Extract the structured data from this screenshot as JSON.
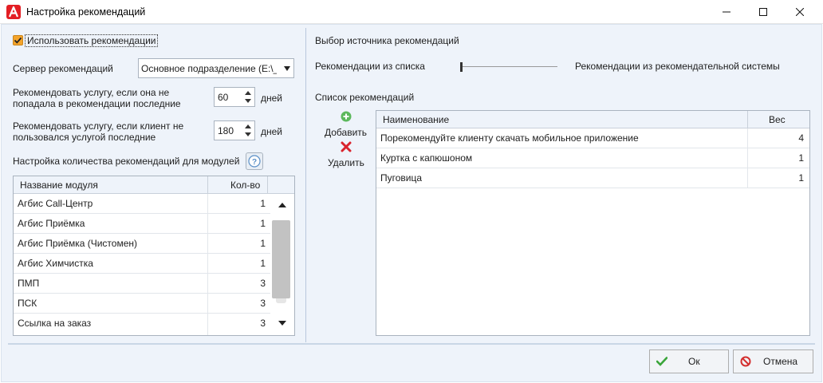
{
  "window": {
    "title": "Настройка рекомендаций"
  },
  "left": {
    "use_recommendations": {
      "label": "Использовать рекомендации",
      "checked": true
    },
    "server": {
      "label": "Сервер рекомендаций",
      "value": "Основное подразделение (E:\\_F"
    },
    "recommend_not_in": {
      "label_line1": "Рекомендовать услугу, если она не",
      "label_line2": "попадала в рекомендации последние",
      "value": "60",
      "unit": "дней"
    },
    "recommend_not_used": {
      "label_line1": "Рекомендовать услугу, если клиент не",
      "label_line2": "пользовался услугой последние",
      "value": "180",
      "unit": "дней"
    },
    "modules_setup_label": "Настройка количества рекомендаций для модулей",
    "modules_grid": {
      "columns": [
        "Название модуля",
        "Кол-во"
      ],
      "rows": [
        {
          "name": "Агбис Call-Центр",
          "count": "1"
        },
        {
          "name": "Агбис Приёмка",
          "count": "1"
        },
        {
          "name": "Агбис Приёмка (Чистомен)",
          "count": "1"
        },
        {
          "name": "Агбис Химчистка",
          "count": "1"
        },
        {
          "name": "ПМП",
          "count": "3"
        },
        {
          "name": "ПСК",
          "count": "3"
        },
        {
          "name": "Ссылка на заказ",
          "count": "3"
        }
      ]
    }
  },
  "right": {
    "source_title": "Выбор источника рекомендаций",
    "source_left": "Рекомендации из списка",
    "source_right": "Рекомендации из рекомендательной системы",
    "list_title": "Список рекомендаций",
    "add_label": "Добавить",
    "delete_label": "Удалить",
    "rec_grid": {
      "columns": [
        "Наименование",
        "Вес"
      ],
      "rows": [
        {
          "name": "Порекомендуйте клиенту скачать мобильное приложение",
          "weight": "4"
        },
        {
          "name": "Куртка с капюшоном",
          "weight": "1"
        },
        {
          "name": "Пуговица",
          "weight": "1"
        }
      ]
    }
  },
  "footer": {
    "ok_label": "Ок",
    "cancel_label": "Отмена"
  },
  "colors": {
    "accent_orange": "#f4a42b",
    "brand_red": "#e31e24",
    "ok_green": "#3aa53a",
    "cancel_red": "#d32f2f"
  }
}
